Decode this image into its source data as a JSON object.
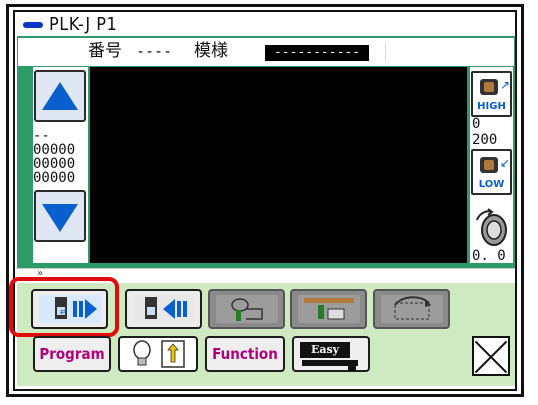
{
  "window": {
    "title": "PLK-J P1"
  },
  "header": {
    "number_label": "番号",
    "number_value": "----",
    "pattern_label": "模様",
    "pattern_value": "-----------"
  },
  "left_values": {
    "dash": "--",
    "v1": "00000",
    "v2": "00000",
    "v3": "00000"
  },
  "right_panel": {
    "high_label": "HIGH",
    "low_label": "LOW",
    "value_top": "0",
    "value_mid": "200",
    "value_bottom": "0. 0"
  },
  "bottom": {
    "program_label": "Program",
    "function_label": "Function",
    "easy_label": "Easy"
  },
  "colors": {
    "green": "#2e9a67",
    "accent_blue": "#0a5fce",
    "highlight": "#e20b0b",
    "magenta": "#b1007c",
    "panel": "#cfe9c0"
  }
}
